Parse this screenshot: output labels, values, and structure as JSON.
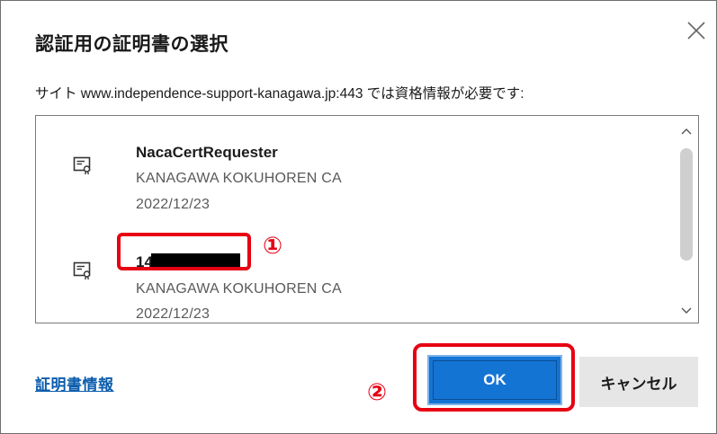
{
  "dialog": {
    "title": "認証用の証明書の選択",
    "subtitle": "サイト www.independence-support-kanagawa.jp:443 では資格情報が必要です:",
    "close_icon": "close-icon"
  },
  "certificates": [
    {
      "name": "NacaCertRequester",
      "issuer": "KANAGAWA KOKUHOREN CA",
      "date": "2022/12/23",
      "icon": "certificate-icon"
    },
    {
      "name": "14",
      "issuer": "KANAGAWA KOKUHOREN CA",
      "date": "2022/12/23",
      "icon": "certificate-icon"
    }
  ],
  "annotations": {
    "marker1": "①",
    "marker2": "②",
    "color": "#e60012"
  },
  "footer": {
    "info_link": "証明書情報",
    "ok_label": "OK",
    "cancel_label": "キャンセル"
  },
  "colors": {
    "primary_button": "#1474d4",
    "link": "#0b5cad"
  }
}
